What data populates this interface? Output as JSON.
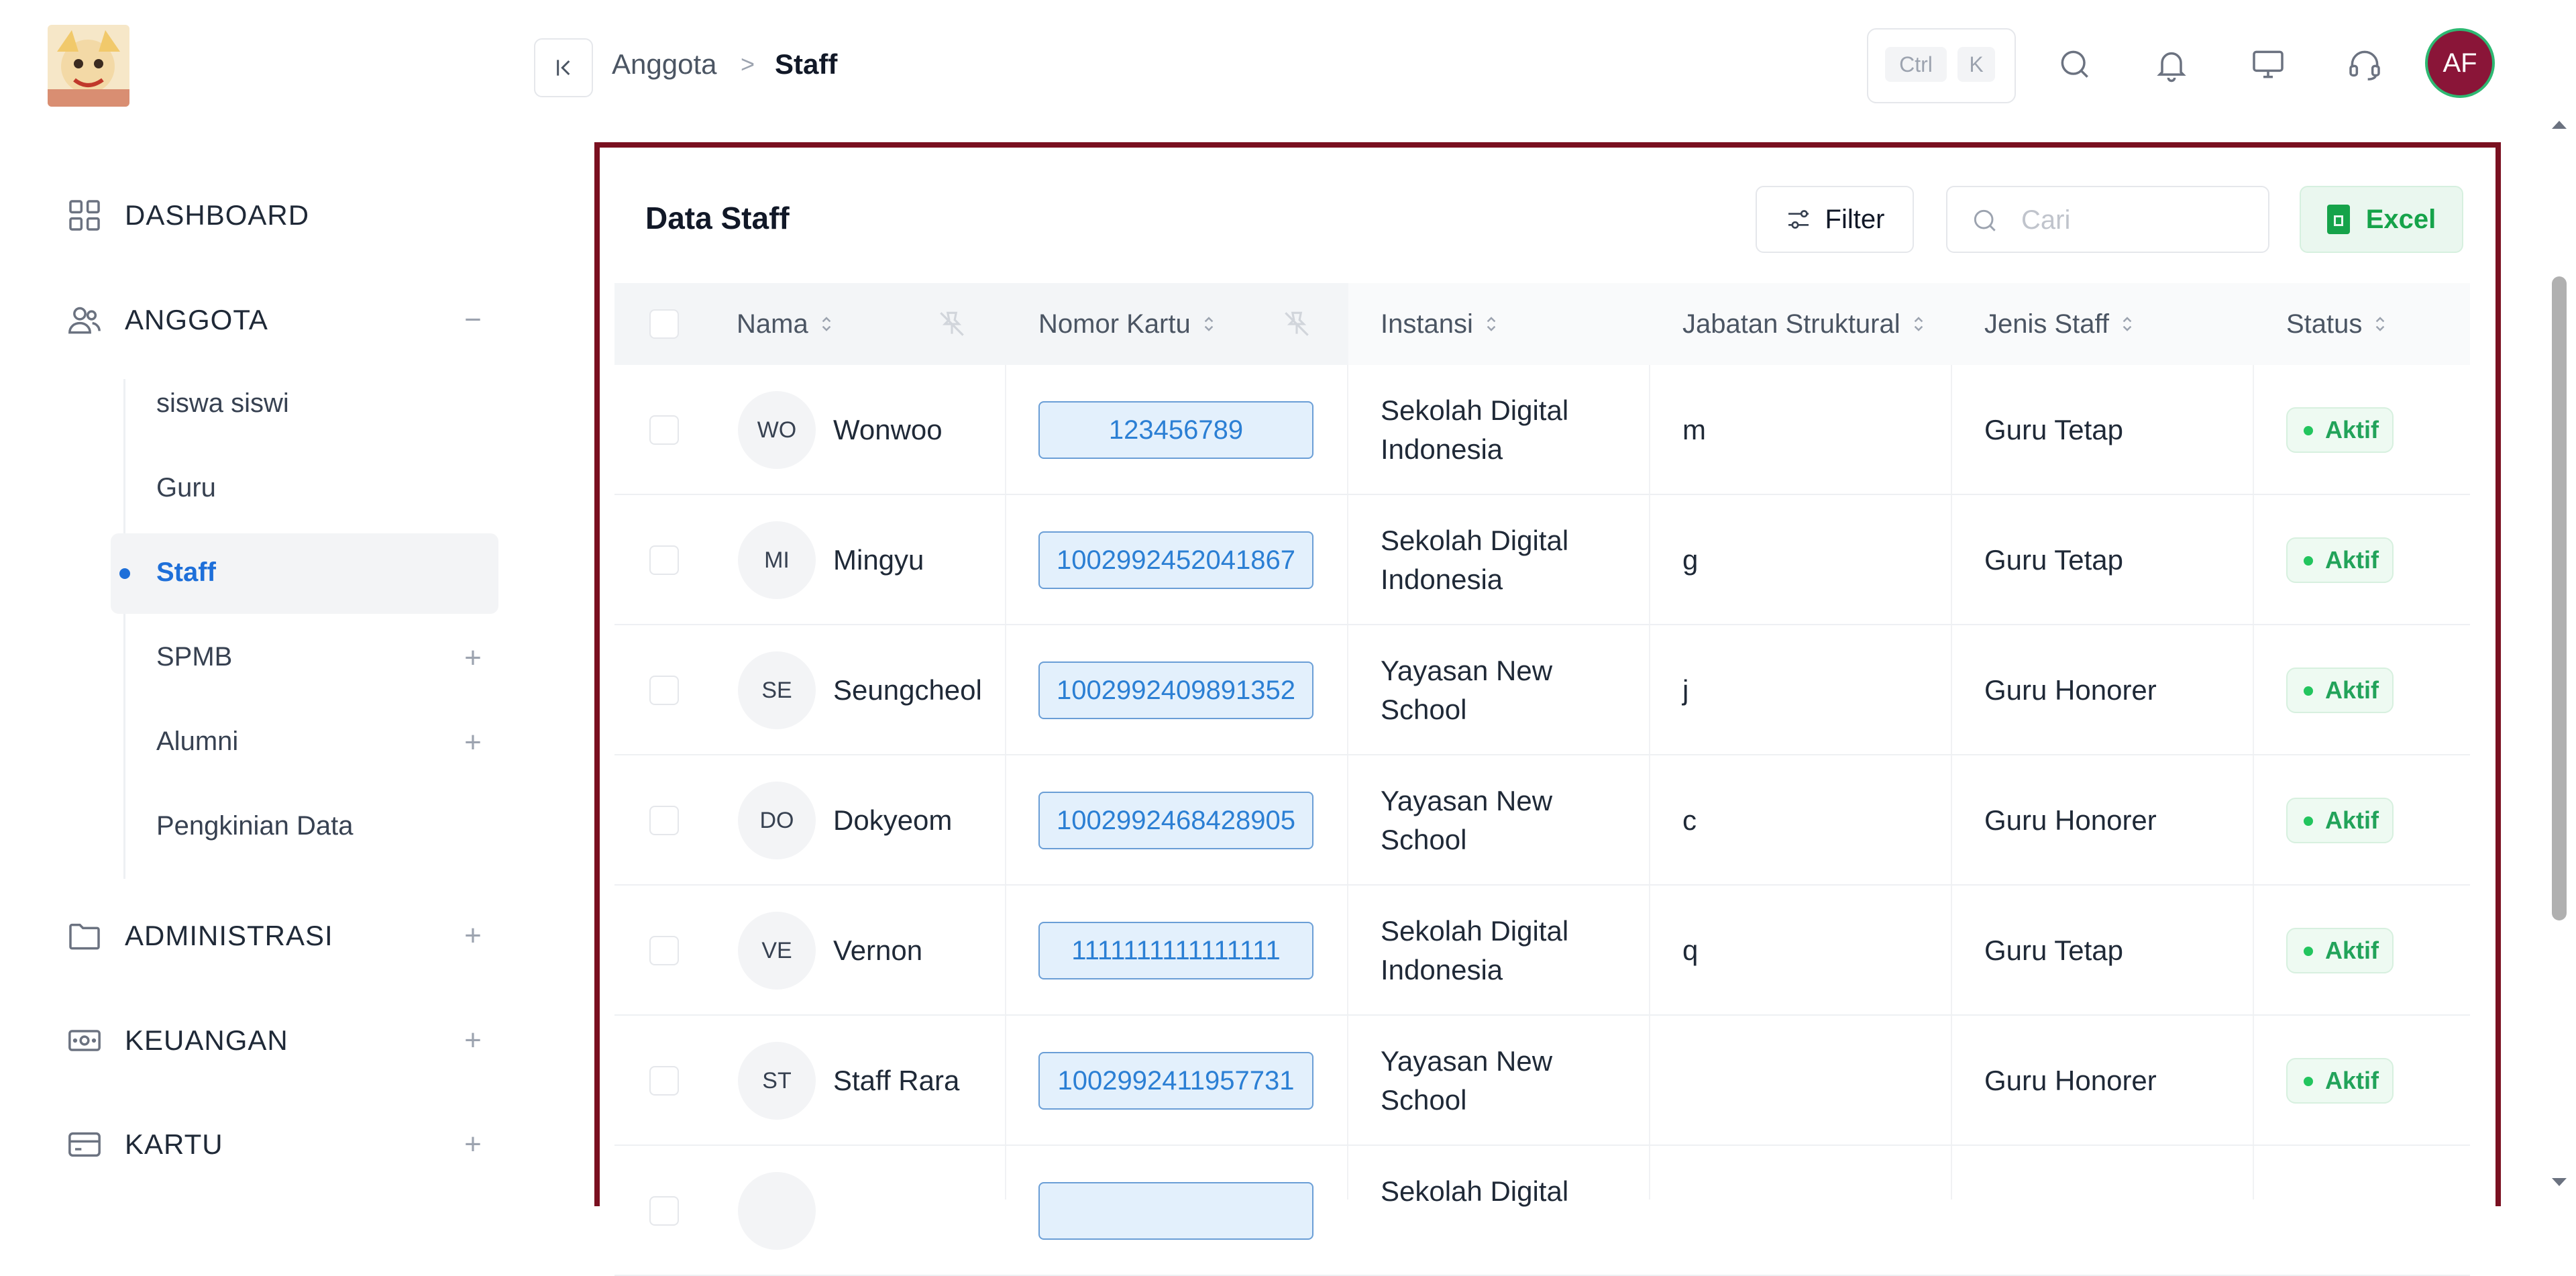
{
  "sidebar": {
    "items": [
      {
        "label": "DASHBOARD",
        "icon": "grid-icon"
      },
      {
        "label": "ANGGOTA",
        "icon": "users-icon",
        "toggle": "−"
      },
      {
        "label": "ADMINISTRASI",
        "icon": "folder-icon",
        "toggle": "+"
      },
      {
        "label": "KEUANGAN",
        "icon": "money-icon",
        "toggle": "+"
      },
      {
        "label": "KARTU",
        "icon": "card-icon",
        "toggle": "+"
      }
    ],
    "anggota_sub": [
      {
        "label": "siswa siswi"
      },
      {
        "label": "Guru"
      },
      {
        "label": "Staff",
        "active": true
      },
      {
        "label": "SPMB",
        "toggle": "+"
      },
      {
        "label": "Alumni",
        "toggle": "+"
      },
      {
        "label": "Pengkinian Data"
      }
    ]
  },
  "header": {
    "breadcrumb": [
      "Anggota",
      "Staff"
    ],
    "separator": ">",
    "shortcut_keys": [
      "Ctrl",
      "K"
    ],
    "avatar_initials": "AF"
  },
  "panel": {
    "title": "Data Staff",
    "filter_label": "Filter",
    "search_placeholder": "Cari",
    "excel_label": "Excel"
  },
  "table": {
    "columns": [
      "Nama",
      "Nomor Kartu",
      "Instansi",
      "Jabatan Struktural",
      "Jenis Staff",
      "Status"
    ],
    "rows": [
      {
        "initials": "WO",
        "nama": "Wonwoo",
        "kartu": "123456789",
        "instansi": [
          "Sekolah Digital",
          "Indonesia"
        ],
        "jabatan": "m",
        "jenis": "Guru Tetap",
        "status": "Aktif"
      },
      {
        "initials": "MI",
        "nama": "Mingyu",
        "kartu": "1002992452041867",
        "instansi": [
          "Sekolah Digital",
          "Indonesia"
        ],
        "jabatan": "g",
        "jenis": "Guru Tetap",
        "status": "Aktif"
      },
      {
        "initials": "SE",
        "nama": "Seungcheol",
        "kartu": "1002992409891352",
        "instansi": [
          "Yayasan New",
          "School"
        ],
        "jabatan": "j",
        "jenis": "Guru Honorer",
        "status": "Aktif"
      },
      {
        "initials": "DO",
        "nama": "Dokyeom",
        "kartu": "1002992468428905",
        "instansi": [
          "Yayasan New",
          "School"
        ],
        "jabatan": "c",
        "jenis": "Guru Honorer",
        "status": "Aktif"
      },
      {
        "initials": "VE",
        "nama": "Vernon",
        "kartu": "1111111111111111",
        "instansi": [
          "Sekolah Digital",
          "Indonesia"
        ],
        "jabatan": "q",
        "jenis": "Guru Tetap",
        "status": "Aktif"
      },
      {
        "initials": "ST",
        "nama": "Staff Rara",
        "kartu": "1002992411957731",
        "instansi": [
          "Yayasan New",
          "School"
        ],
        "jabatan": "",
        "jenis": "Guru Honorer",
        "status": "Aktif"
      },
      {
        "initials": "",
        "nama": "",
        "kartu": "",
        "instansi": [
          "Sekolah Digital",
          ""
        ],
        "jabatan": "",
        "jenis": "",
        "status": ""
      }
    ]
  },
  "colors": {
    "accent": "#1e6fd9",
    "panel_border": "#7a1020",
    "avatar_bg": "#8a1538",
    "success": "#22a35a"
  }
}
